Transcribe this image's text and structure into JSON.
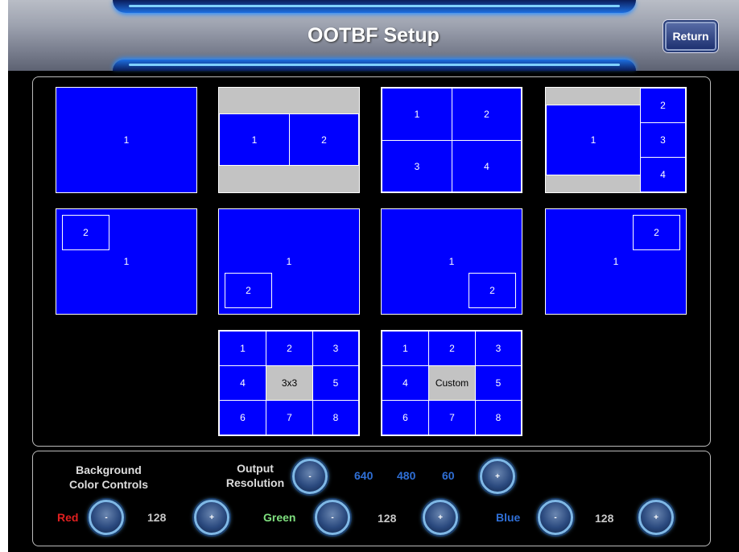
{
  "header": {
    "title": "OOTBF Setup",
    "return_label": "Return"
  },
  "layouts": {
    "l1": [
      "1"
    ],
    "l2": [
      "1",
      "2"
    ],
    "l3": [
      "1",
      "2",
      "3",
      "4"
    ],
    "l4": [
      "1",
      "2",
      "3",
      "4"
    ],
    "l5": [
      "1",
      "2"
    ],
    "l6": [
      "1",
      "2"
    ],
    "l7": [
      "1",
      "2"
    ],
    "l8": [
      "1",
      "2"
    ],
    "grid3x3": [
      "1",
      "2",
      "3",
      "4",
      "3x3",
      "5",
      "6",
      "7",
      "8"
    ],
    "grid_custom": [
      "1",
      "2",
      "3",
      "4",
      "Custom",
      "5",
      "6",
      "7",
      "8"
    ]
  },
  "controls": {
    "bg_label_line1": "Background",
    "bg_label_line2": "Color Controls",
    "output_label_line1": "Output",
    "output_label_line2": "Resolution",
    "res_width": "640",
    "res_height": "480",
    "res_rate": "60",
    "red_label": "Red",
    "green_label": "Green",
    "blue_label": "Blue",
    "red_value": "128",
    "green_value": "128",
    "blue_value": "128",
    "minus": "-",
    "plus": "+"
  },
  "colors": {
    "tile_blue": "#0000ff",
    "grey_fill": "#c3c3c3",
    "red": "#e02020",
    "green": "#7fe07f",
    "blue": "#2f6fd6"
  }
}
